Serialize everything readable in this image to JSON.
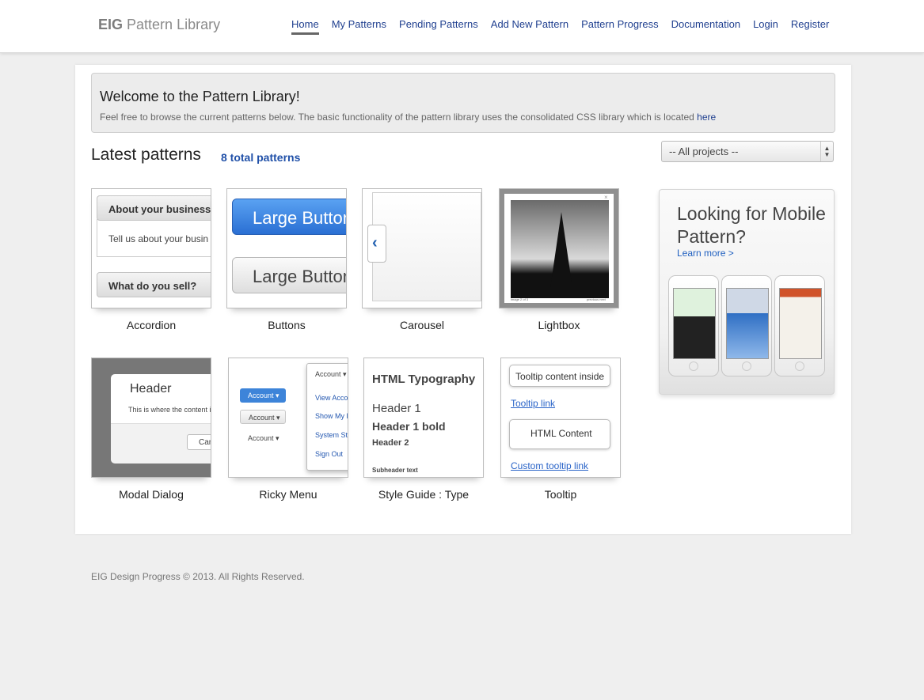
{
  "brand": {
    "bold": "EIG",
    "rest": "Pattern Library"
  },
  "nav": [
    "Home",
    "My Patterns",
    "Pending Patterns",
    "Add New Pattern",
    "Pattern Progress",
    "Documentation",
    "Login",
    "Register"
  ],
  "welcome": {
    "title": "Welcome to the Pattern Library!",
    "text": "Feel free to browse the current patterns below. The basic functionality of the pattern library uses the consolidated CSS library which is located ",
    "link": "here"
  },
  "latest": {
    "title": "Latest patterns",
    "count": "8 total patterns"
  },
  "project_select": {
    "selected": "-- All projects --"
  },
  "patterns": [
    {
      "label": "Accordion"
    },
    {
      "label": "Buttons"
    },
    {
      "label": "Carousel"
    },
    {
      "label": "Lightbox"
    },
    {
      "label": "Modal Dialog"
    },
    {
      "label": "Ricky Menu"
    },
    {
      "label": "Style Guide : Type"
    },
    {
      "label": "Tooltip"
    }
  ],
  "thumbs": {
    "accordion": {
      "bar1": "About your business",
      "body": "Tell us about your busin",
      "bar2": "What do you sell?"
    },
    "buttons": {
      "label1": "Large Button",
      "label2": "Large Button"
    },
    "lightbox": {
      "caption_left": "image 2 of 3",
      "caption_right": "previous  next"
    },
    "modal": {
      "header": "Header",
      "text": "This is where the content i",
      "button": "Can"
    },
    "ricky": {
      "b1": "Account ▾",
      "b2": "Account ▾",
      "b3": "Account ▾",
      "panel_head": "Account ▾",
      "items": [
        "View Accou",
        "Show My P",
        "System Sta",
        "Sign Out"
      ]
    },
    "type": {
      "h": "HTML Typography",
      "h1": "Header 1",
      "h1b": "Header 1 bold",
      "h2": "Header 2",
      "sub": "Subheader text"
    },
    "tooltip": {
      "tip1": "Tooltip content inside",
      "link1": "Tooltip link",
      "tip2": "HTML Content",
      "link2": "Custom tooltip link"
    }
  },
  "promo": {
    "title": "Looking for Mobile Pattern?",
    "link": "Learn more >"
  },
  "footer": "EIG Design Progress © 2013. All Rights Reserved."
}
